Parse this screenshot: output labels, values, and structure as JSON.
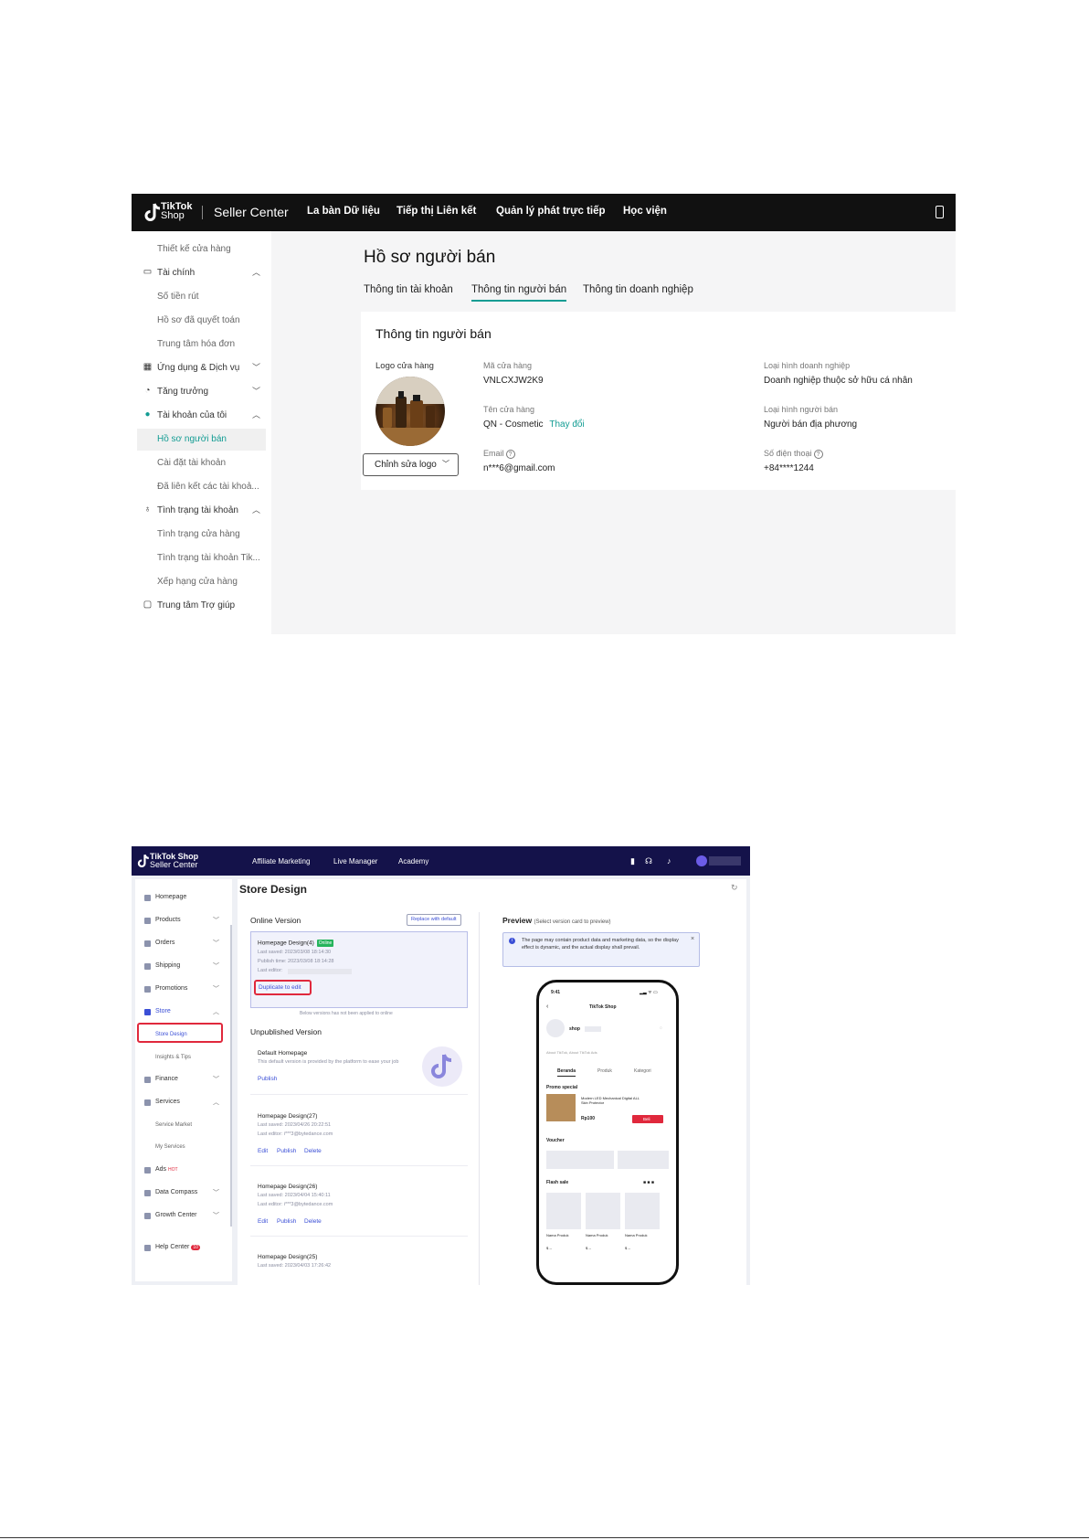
{
  "screenshot1": {
    "brand_line1": "TikTok",
    "brand_line2": "Shop",
    "app_title": "Seller Center",
    "nav": [
      "La bàn Dữ liệu",
      "Tiếp thị Liên kết",
      "Quản lý phát trực tiếp",
      "Học viện"
    ],
    "sidebar": [
      {
        "label": "Thiết kế cửa hàng",
        "type": "child"
      },
      {
        "label": "Tài chính",
        "type": "section",
        "icon": "wallet-icon",
        "chev": "up"
      },
      {
        "label": "Số tiền rút",
        "type": "child"
      },
      {
        "label": "Hồ sơ đã quyết toán",
        "type": "child"
      },
      {
        "label": "Trung tâm hóa đơn",
        "type": "child"
      },
      {
        "label": "Ứng dụng & Dịch vụ",
        "type": "section",
        "icon": "apps-icon",
        "chev": "down"
      },
      {
        "label": "Tăng trưởng",
        "type": "section",
        "icon": "growth-icon",
        "chev": "down"
      },
      {
        "label": "Tài khoản của tôi",
        "type": "section",
        "icon": "user-icon",
        "chev": "up"
      },
      {
        "label": "Hồ sơ người bán",
        "type": "active"
      },
      {
        "label": "Cài đặt tài khoản",
        "type": "child"
      },
      {
        "label": "Đã liên kết các tài khoả...",
        "type": "child"
      },
      {
        "label": "Tình trạng tài khoản",
        "type": "section",
        "icon": "trophy-icon",
        "chev": "up"
      },
      {
        "label": "Tình trạng cửa hàng",
        "type": "child"
      },
      {
        "label": "Tình trạng tài khoản Tik...",
        "type": "child"
      },
      {
        "label": "Xếp hạng cửa hàng",
        "type": "child"
      },
      {
        "label": "Trung tâm Trợ giúp",
        "type": "section",
        "icon": "help-chat-icon"
      }
    ],
    "page_title": "Hồ sơ người bán",
    "tabs": [
      "Thông tin tài khoản",
      "Thông tin người bán",
      "Thông tin doanh nghiệp"
    ],
    "card_title": "Thông tin người bán",
    "logo_label": "Logo cửa hàng",
    "edit_logo_button": "Chỉnh sửa logo",
    "fields": {
      "shop_code_label": "Mã cửa hàng",
      "shop_code": "VNLCXJW2K9",
      "shop_name_label": "Tên cửa hàng",
      "shop_name": "QN - Cosmetic",
      "change_link": "Thay đổi",
      "email_label": "Email",
      "email": "n***6@gmail.com",
      "biz_type_label": "Loại hình doanh nghiệp",
      "biz_type": "Doanh nghiệp thuộc sở hữu cá nhân",
      "seller_type_label": "Loại hình người bán",
      "seller_type": "Người bán địa phương",
      "phone_label": "Số điện thoại",
      "phone": "+84****1244"
    }
  },
  "screenshot2": {
    "brand_line1": "TikTok Shop",
    "brand_line2": "Seller Center",
    "nav": [
      "Affiliate Marketing",
      "Live Manager",
      "Academy"
    ],
    "sidebar": [
      {
        "label": "Homepage",
        "type": "section"
      },
      {
        "label": "Products",
        "type": "section",
        "chev": "down"
      },
      {
        "label": "Orders",
        "type": "section",
        "chev": "down"
      },
      {
        "label": "Shipping",
        "type": "section",
        "chev": "down"
      },
      {
        "label": "Promotions",
        "type": "section",
        "chev": "down"
      },
      {
        "label": "Store",
        "type": "sel",
        "chev": "up"
      },
      {
        "label": "Store Design",
        "type": "child-sel"
      },
      {
        "label": "Insights & Tips",
        "type": "child"
      },
      {
        "label": "Finance",
        "type": "section",
        "chev": "down"
      },
      {
        "label": "Services",
        "type": "section",
        "chev": "up"
      },
      {
        "label": "Service Market",
        "type": "child"
      },
      {
        "label": "My Services",
        "type": "child"
      },
      {
        "label": "Ads",
        "type": "section",
        "badge": "HOT"
      },
      {
        "label": "Data Compass",
        "type": "section",
        "chev": "down"
      },
      {
        "label": "Growth Center",
        "type": "section",
        "chev": "down"
      },
      {
        "label": "Help Center",
        "type": "section",
        "badge": "10"
      }
    ],
    "page_title": "Store Design",
    "online_version": "Online Version",
    "replace_button": "Replace with default",
    "online_card": {
      "name": "Homepage Design(4)",
      "badge": "Online",
      "last_saved": "Last saved: 2023/03/08 18:14:30",
      "publish_time": "Publish time: 2023/03/08 18:14:28",
      "last_editor": "Last editor:",
      "duplicate_button": "Duplicate to edit"
    },
    "divider_note": "Below versions has not been applied to online",
    "unpublished_version": "Unpublished Version",
    "default_card": {
      "name": "Default Homepage",
      "desc": "This default version is provided by the platform to ease your job",
      "publish": "Publish"
    },
    "versions": [
      {
        "name": "Homepage Design(27)",
        "saved": "Last saved: 2023/04/26 20:22:51",
        "editor": "Last editor: i***3@bytedance.com"
      },
      {
        "name": "Homepage Design(26)",
        "saved": "Last saved: 2023/04/04 15:40:11",
        "editor": "Last editor: i***3@bytedance.com"
      },
      {
        "name": "Homepage Design(25)",
        "saved": "Last saved: 2023/04/03 17:26:42",
        "editor": ""
      }
    ],
    "actions": {
      "edit": "Edit",
      "publish": "Publish",
      "delete": "Delete"
    },
    "preview_title": "Preview",
    "preview_hint": "(Select version card to preview)",
    "info_text": "The page may contain product data and marketing data, so the display effect is dynamic, and the actual display shall prevail.",
    "phone": {
      "time": "9:41",
      "title": "TikTok Shop",
      "shop": "shop",
      "about": "About TikTok, About TikTok Ads",
      "tabs": [
        "Beranda",
        "Produk",
        "Kategori"
      ],
      "promo": "Promo special",
      "product_name": "Modern LED Mechanical Digital ALL Skin Protector",
      "price": "Rp100",
      "buy": "Beli",
      "voucher": "Voucher",
      "flash_sale": "Flash sale",
      "product_label": "Nama Produk",
      "price_placeholder": "$ --"
    }
  }
}
